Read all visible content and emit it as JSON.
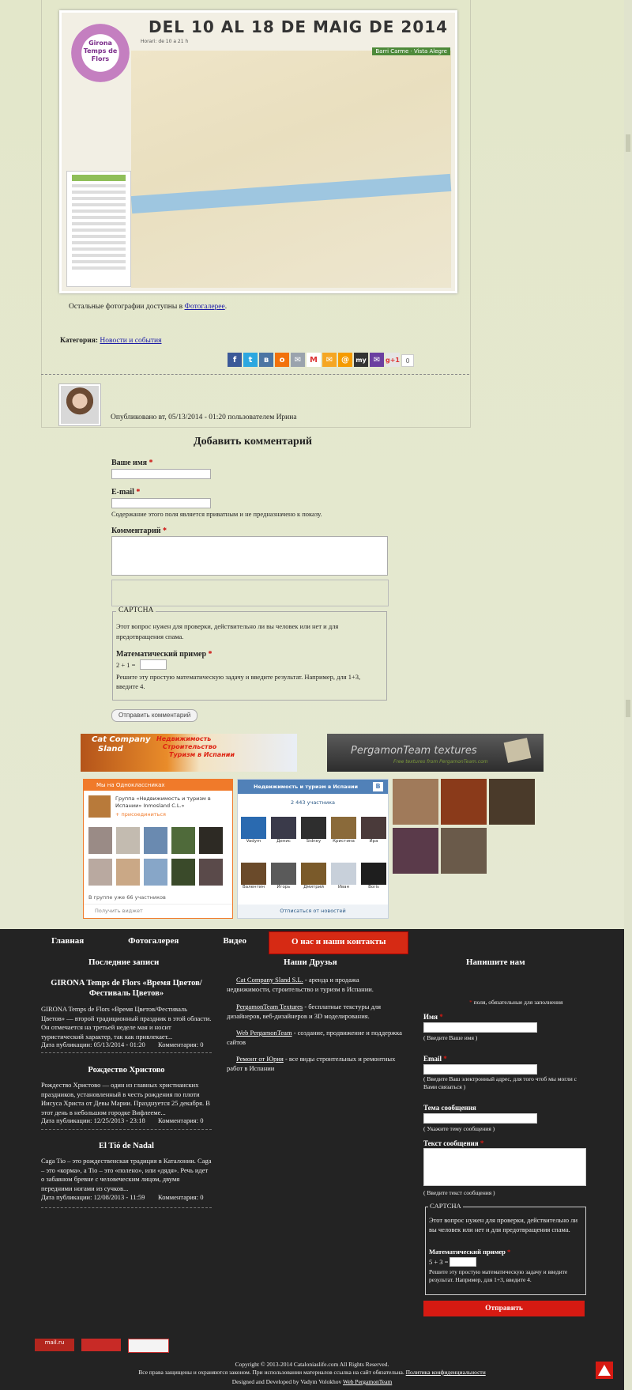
{
  "map": {
    "title": "DEL 10 AL 18 DE MAIG DE 2014",
    "subtitle": "Horari: de 10 a 21 h",
    "logo_line1": "Girona",
    "logo_line2": "Temps de Flors",
    "badge": "Barri Carme · Vista Alegre"
  },
  "article": {
    "photos_text": "Остальные фотографии доступны в",
    "photos_link": "Фотогалерее",
    "photos_end": ".",
    "category_label": "Категория:",
    "category_link": "Новости и события",
    "share_count": "0",
    "posted": "Опубликовано вт, 05/13/2014 - 01:20 пользователем Ирина"
  },
  "comment_form": {
    "title": "Добавить комментарий",
    "name_label": "Ваше имя",
    "email_label": "E-mail",
    "email_hint": "Содержание этого поля является приватным и не предназначено к показу.",
    "comment_label": "Комментарий",
    "captcha_legend": "CAPTCHA",
    "captcha_desc": "Этот вопрос нужен для проверки, действительно ли вы человек или нет и для предотвращения спама.",
    "math_label": "Математический пример",
    "math_question": "2 + 1 =",
    "math_hint": "Решите эту простую математическую задачу и введите результат. Например, для 1+3, введите 4.",
    "submit": "Отправить комментарий",
    "required": "*"
  },
  "banners": {
    "b1_line1": "Cat Company",
    "b1_line2": "Sland",
    "b1_line3": "Недвижимость",
    "b1_line4": "Строительство",
    "b1_line5": "Туризм в Испании",
    "b2_line1": "PergamonTeam textures",
    "b2_line2": "Free textures from PergamonTeam.com"
  },
  "ok_widget": {
    "header": "Мы на Одноклассниках",
    "group": "Группа «Недвижимость и туризм в Испании» Inmosland C.L.»",
    "join": "+ присоединиться",
    "members": "В группе уже 66 участников",
    "widget_link": "Получить виджет"
  },
  "vk_widget": {
    "header": "Недвижимость и туризм в Испании",
    "count": "2 443 участника",
    "names_row1": [
      "Vadym",
      "Денис",
      "Sidney",
      "Кристина",
      "Ира"
    ],
    "names_row2": [
      "Валентин",
      "Игорь",
      "Дмитрий",
      "Иван",
      "Boris"
    ],
    "unsubscribe": "Отписаться от новостей"
  },
  "nav": {
    "items": [
      "Главная",
      "Фотогалерея",
      "Видео",
      "О нас и наши контакты"
    ]
  },
  "footer": {
    "recent_title": "Последние записи",
    "posts": [
      {
        "title": "GIRONA Temps de Flors «Время Цветов/ Фестиваль Цветов»",
        "text": "GIRONA Temps de Flors «Время Цветов/Фестиваль Цветов» — второй традиционный праздник в этой области. Он отмечается на третьей неделе мая и носит туристический характер, так как привлекает...",
        "date": "Дата публикации: 05/13/2014 - 01:20",
        "comments": "Комментария: 0"
      },
      {
        "title": "Рождество Христово",
        "text": "Рождество Христово — один из главных христианских праздников, установленный в честь рождения по плоти Иисуса Христа от Девы Марии. Празднуется 25 декабря. В этот день в небольшом городке Вифлееме...",
        "date": "Дата публикации: 12/25/2013 - 23:18",
        "comments": "Комментария: 0"
      },
      {
        "title": "El Tió de Nadal",
        "text": "Caga Tio – это рождественская традиция в Каталонии. Caga – это «корма», а Tio – это «полено», или «дядя». Речь идет о забавном бревне с человеческим лицом, двумя передними ногами из сучков...",
        "date": "Дата публикации: 12/08/2013 - 11:59",
        "comments": "Комментария: 0"
      }
    ],
    "friends_title": "Наши Друзья",
    "friends": [
      {
        "link": "Cat Company Sland S.L.",
        "text": " - аренда и продажа недвижимости,  строительство и туризм в Испании."
      },
      {
        "link": "PergamonTeam Textures",
        "text": " - бесплатные текстуры для дизайнеров, веб-дизайнеров и 3D моделирования."
      },
      {
        "link": "Web PergamonTeam",
        "text": " - создание, продвижение и поддержка сайтов"
      },
      {
        "link": "Ремонт от Юрия",
        "text": " - все виды стронтельных и ремонтных работ в Испании"
      }
    ],
    "contact_title": "Напишите нам",
    "required_note": "поля, обязательные для заполнения",
    "name_label": "Имя",
    "name_hint": "( Введите Ваше имя )",
    "email_label": "Email",
    "email_hint": "( Введите Ваш электронный адрес, для того чтоб мы могли с Вами связаться )",
    "subject_label": "Тема сообщения",
    "subject_hint": "( Укажите тему сообщения )",
    "message_label": "Текст сообщения",
    "message_hint": "( Введите текст сообщения )",
    "captcha_legend": "CAPTCHA",
    "captcha_desc": "Этот вопрос нужен для проверки, действительно ли вы человек или нет и для предотвращения спама.",
    "math_label": "Математический пример",
    "math_question": "5 + 3 =",
    "math_hint": "Решите эту простую математическую задачу и введите результат. Например, для 1+3, введите 4.",
    "send": "Отправить",
    "copyright": "Copyright © 2013-2014 Cataloniaslife.com All Rights Reserved.",
    "rights": "Все права защищены и охраняются законом. При использовании материалов ссылка на сайт обязательна.",
    "privacy_link": "Политика конфиденциальности",
    "designed": "Designed and Developed by Vadym Volokhov",
    "designed_link": "Web PergamonTeam",
    "counter1": "mail.ru"
  },
  "colors": {
    "accent": "#d61a12",
    "footer_bg": "#232323",
    "page_bg": "#e2e6c9",
    "vk": "#5181b8",
    "ok": "#f07a2a"
  }
}
